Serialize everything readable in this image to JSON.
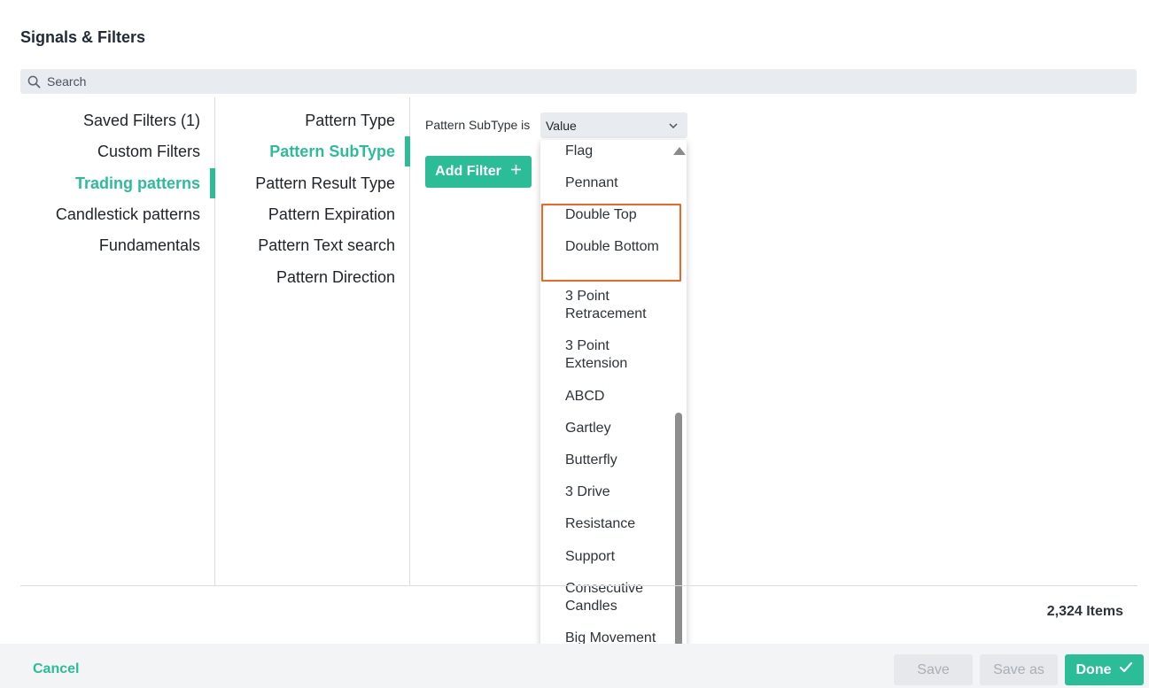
{
  "dialog": {
    "title": "Signals & Filters"
  },
  "search": {
    "placeholder": "Search"
  },
  "categories": [
    {
      "label": "Saved Filters (1)",
      "active": false
    },
    {
      "label": "Custom Filters",
      "active": false
    },
    {
      "label": "Trading patterns",
      "active": true
    },
    {
      "label": "Candlestick patterns",
      "active": false
    },
    {
      "label": "Fundamentals",
      "active": false
    }
  ],
  "subcategories": [
    {
      "label": "Pattern Type",
      "active": false
    },
    {
      "label": "Pattern SubType",
      "active": true
    },
    {
      "label": "Pattern Result Type",
      "active": false
    },
    {
      "label": "Pattern Expiration",
      "active": false
    },
    {
      "label": "Pattern Text search",
      "active": false
    },
    {
      "label": "Pattern Direction",
      "active": false
    }
  ],
  "filter": {
    "label": "Pattern SubType is",
    "select_value": "Value",
    "add_button": "Add Filter"
  },
  "dropdown": {
    "options": [
      "Flag",
      "Pennant",
      "Double Top",
      "Double Bottom",
      "3 Point Retracement",
      "3 Point Extension",
      "ABCD",
      "Gartley",
      "Butterfly",
      "3 Drive",
      "Resistance",
      "Support",
      "Consecutive Candles",
      "Big Movement"
    ],
    "highlighted": [
      "Double Top",
      "Double Bottom"
    ]
  },
  "results": {
    "count": "2,324 Items"
  },
  "footer": {
    "cancel": "Cancel",
    "save": "Save",
    "save_as": "Save as",
    "done": "Done"
  },
  "colors": {
    "accent": "#2bbd98",
    "highlight_border": "#f26522",
    "panel_bg": "#e8ebef"
  }
}
